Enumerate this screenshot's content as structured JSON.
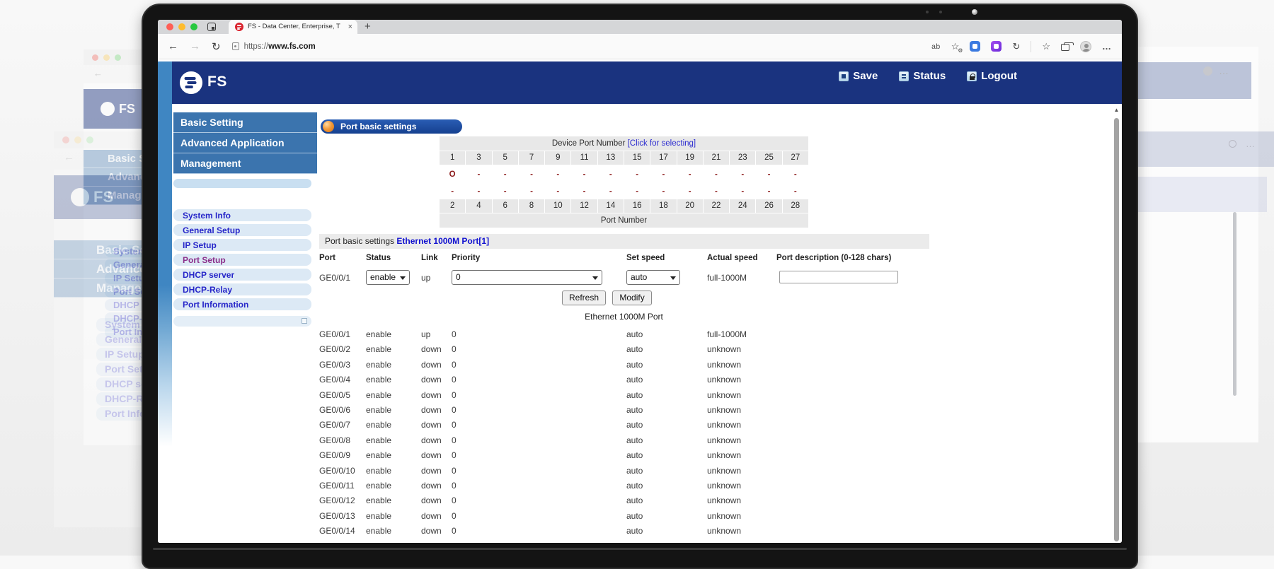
{
  "browser": {
    "tab_title": "FS - Data Center, Enterprise, T",
    "url_scheme": "https://",
    "url_host": "www.fs.com"
  },
  "icons": {
    "back": "←",
    "forward": "→",
    "reload": "↻",
    "close": "×",
    "new_tab": "+",
    "read_aloud": "ab",
    "favorites": "☆",
    "gear": "⚙",
    "sync": "↻",
    "ellipsis": "…",
    "scroll_up": "▲"
  },
  "header": {
    "logo_text": "FS",
    "actions": [
      {
        "label": "Save"
      },
      {
        "label": "Status"
      },
      {
        "label": "Logout"
      }
    ]
  },
  "sidebar": {
    "nav": [
      "Basic Setting",
      "Advanced Application",
      "Management"
    ],
    "menu": [
      {
        "label": "System Info",
        "visited": false
      },
      {
        "label": "General Setup",
        "visited": false
      },
      {
        "label": "IP Setup",
        "visited": false
      },
      {
        "label": "Port Setup",
        "visited": true
      },
      {
        "label": "DHCP server",
        "visited": false
      },
      {
        "label": "DHCP-Relay",
        "visited": false
      },
      {
        "label": "Port Information",
        "visited": false
      }
    ]
  },
  "main": {
    "section_title": "Port basic settings",
    "port_grid": {
      "title": "Device Port Number",
      "select_link": "[Click for selecting]",
      "odd_ports": [
        1,
        3,
        5,
        7,
        9,
        11,
        13,
        15,
        17,
        19,
        21,
        23,
        25,
        27
      ],
      "even_ports": [
        2,
        4,
        6,
        8,
        10,
        12,
        14,
        16,
        18,
        20,
        22,
        24,
        26,
        28
      ],
      "status_row_top": [
        "O",
        "-",
        "-",
        "-",
        "-",
        "-",
        "-",
        "-",
        "-",
        "-",
        "-",
        "-",
        "-",
        "-"
      ],
      "status_row_bottom": [
        "-",
        "-",
        "-",
        "-",
        "-",
        "-",
        "-",
        "-",
        "-",
        "-",
        "-",
        "-",
        "-",
        "-"
      ],
      "footer": "Port Number"
    },
    "settings_bar": {
      "prefix": "Port basic settings",
      "port_link": "Ethernet 1000M Port[1]"
    },
    "columns": [
      "Port",
      "Status",
      "Link",
      "Priority",
      "Set speed",
      "Actual speed",
      "Port description (0-128 chars)"
    ],
    "form": {
      "port": "GE0/0/1",
      "status": "enable",
      "link": "up",
      "priority": "0",
      "set_speed": "auto",
      "actual_speed": "full-1000M",
      "description": ""
    },
    "actions": {
      "refresh": "Refresh",
      "modify": "Modify"
    },
    "table": {
      "title": "Ethernet 1000M Port",
      "rows": [
        {
          "port": "GE0/0/1",
          "status": "enable",
          "link": "up",
          "priority": "0",
          "set_speed": "auto",
          "actual_speed": "full-1000M"
        },
        {
          "port": "GE0/0/2",
          "status": "enable",
          "link": "down",
          "priority": "0",
          "set_speed": "auto",
          "actual_speed": "unknown"
        },
        {
          "port": "GE0/0/3",
          "status": "enable",
          "link": "down",
          "priority": "0",
          "set_speed": "auto",
          "actual_speed": "unknown"
        },
        {
          "port": "GE0/0/4",
          "status": "enable",
          "link": "down",
          "priority": "0",
          "set_speed": "auto",
          "actual_speed": "unknown"
        },
        {
          "port": "GE0/0/5",
          "status": "enable",
          "link": "down",
          "priority": "0",
          "set_speed": "auto",
          "actual_speed": "unknown"
        },
        {
          "port": "GE0/0/6",
          "status": "enable",
          "link": "down",
          "priority": "0",
          "set_speed": "auto",
          "actual_speed": "unknown"
        },
        {
          "port": "GE0/0/7",
          "status": "enable",
          "link": "down",
          "priority": "0",
          "set_speed": "auto",
          "actual_speed": "unknown"
        },
        {
          "port": "GE0/0/8",
          "status": "enable",
          "link": "down",
          "priority": "0",
          "set_speed": "auto",
          "actual_speed": "unknown"
        },
        {
          "port": "GE0/0/9",
          "status": "enable",
          "link": "down",
          "priority": "0",
          "set_speed": "auto",
          "actual_speed": "unknown"
        },
        {
          "port": "GE0/0/10",
          "status": "enable",
          "link": "down",
          "priority": "0",
          "set_speed": "auto",
          "actual_speed": "unknown"
        },
        {
          "port": "GE0/0/11",
          "status": "enable",
          "link": "down",
          "priority": "0",
          "set_speed": "auto",
          "actual_speed": "unknown"
        },
        {
          "port": "GE0/0/12",
          "status": "enable",
          "link": "down",
          "priority": "0",
          "set_speed": "auto",
          "actual_speed": "unknown"
        },
        {
          "port": "GE0/0/13",
          "status": "enable",
          "link": "down",
          "priority": "0",
          "set_speed": "auto",
          "actual_speed": "unknown"
        },
        {
          "port": "GE0/0/14",
          "status": "enable",
          "link": "down",
          "priority": "0",
          "set_speed": "auto",
          "actual_speed": "unknown"
        }
      ]
    }
  },
  "colors": {
    "header_navy": "#1A337F",
    "nav_blue": "#3B74AE",
    "stripe_blue": "#3F86C2",
    "pill_bg": "#DCE9F5",
    "link_blue": "#2626C9",
    "visited_purple": "#8B2F8B",
    "section_blue": "#1C4C9C",
    "accent_orange": "#F08018",
    "grid_gray": "#E8E8E8",
    "status_red": "#8B1A1A",
    "traffic_red": "#FF5F57",
    "traffic_yellow": "#FEBC2E",
    "traffic_green": "#28C840"
  }
}
